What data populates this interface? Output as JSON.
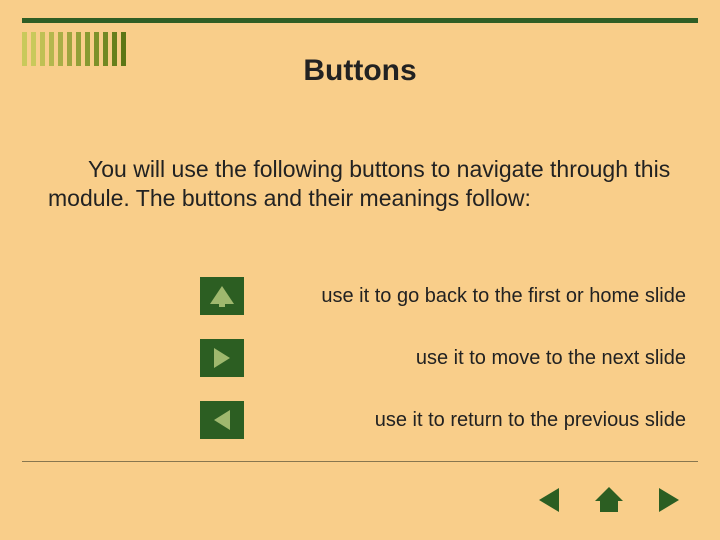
{
  "colors": {
    "bar_colors": [
      "#c9c95b",
      "#c9c95b",
      "#bfc054",
      "#b4b74d",
      "#a9ae46",
      "#9ea53f",
      "#93a038",
      "#889a31",
      "#7d912a",
      "#728823",
      "#677f1c",
      "#5c7615"
    ]
  },
  "title": "Buttons",
  "intro": "You will use the following buttons to navigate through this module. The buttons and their meanings follow:",
  "legend": [
    {
      "icon": "home",
      "desc": "use it to go back to the first or home slide"
    },
    {
      "icon": "next",
      "desc": "use it to move to the next slide"
    },
    {
      "icon": "prev",
      "desc": "use it to return to the previous slide"
    }
  ],
  "footer": {
    "buttons": [
      "prev",
      "home",
      "next"
    ]
  }
}
